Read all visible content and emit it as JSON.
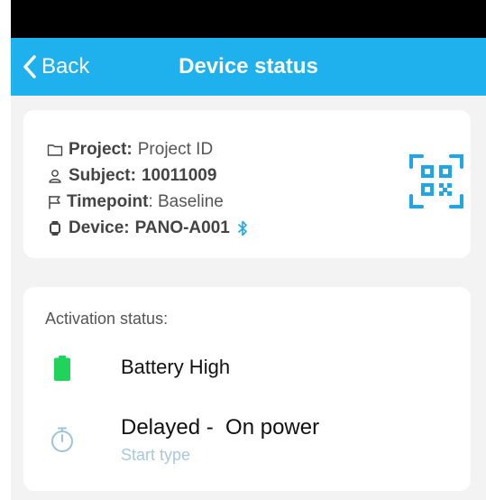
{
  "header": {
    "back_label": "Back",
    "title": "Device status"
  },
  "info": {
    "project_label": "Project:",
    "project_value": "Project ID",
    "subject_label": "Subject:",
    "subject_value": "10011009",
    "timepoint_label": "Timepoint",
    "timepoint_value": ": Baseline",
    "device_label": "Device:",
    "device_value": "PANO-A001"
  },
  "status": {
    "heading": "Activation status:",
    "battery_label": "Battery High",
    "start_value": "Delayed -  On power",
    "start_caption": "Start type"
  },
  "icons": {
    "back": "chevron-left-icon",
    "project": "folder-icon",
    "subject": "person-icon",
    "timepoint": "flag-icon",
    "device": "watch-icon",
    "bluetooth": "bluetooth-icon",
    "scan": "qr-scan-icon",
    "battery": "battery-icon",
    "timer": "stopwatch-icon"
  },
  "colors": {
    "app_bar": "#1fb1ee",
    "accent": "#1fa6e8",
    "battery": "#20d35a",
    "caption": "#a8c9da",
    "background": "#f3f3f3"
  }
}
